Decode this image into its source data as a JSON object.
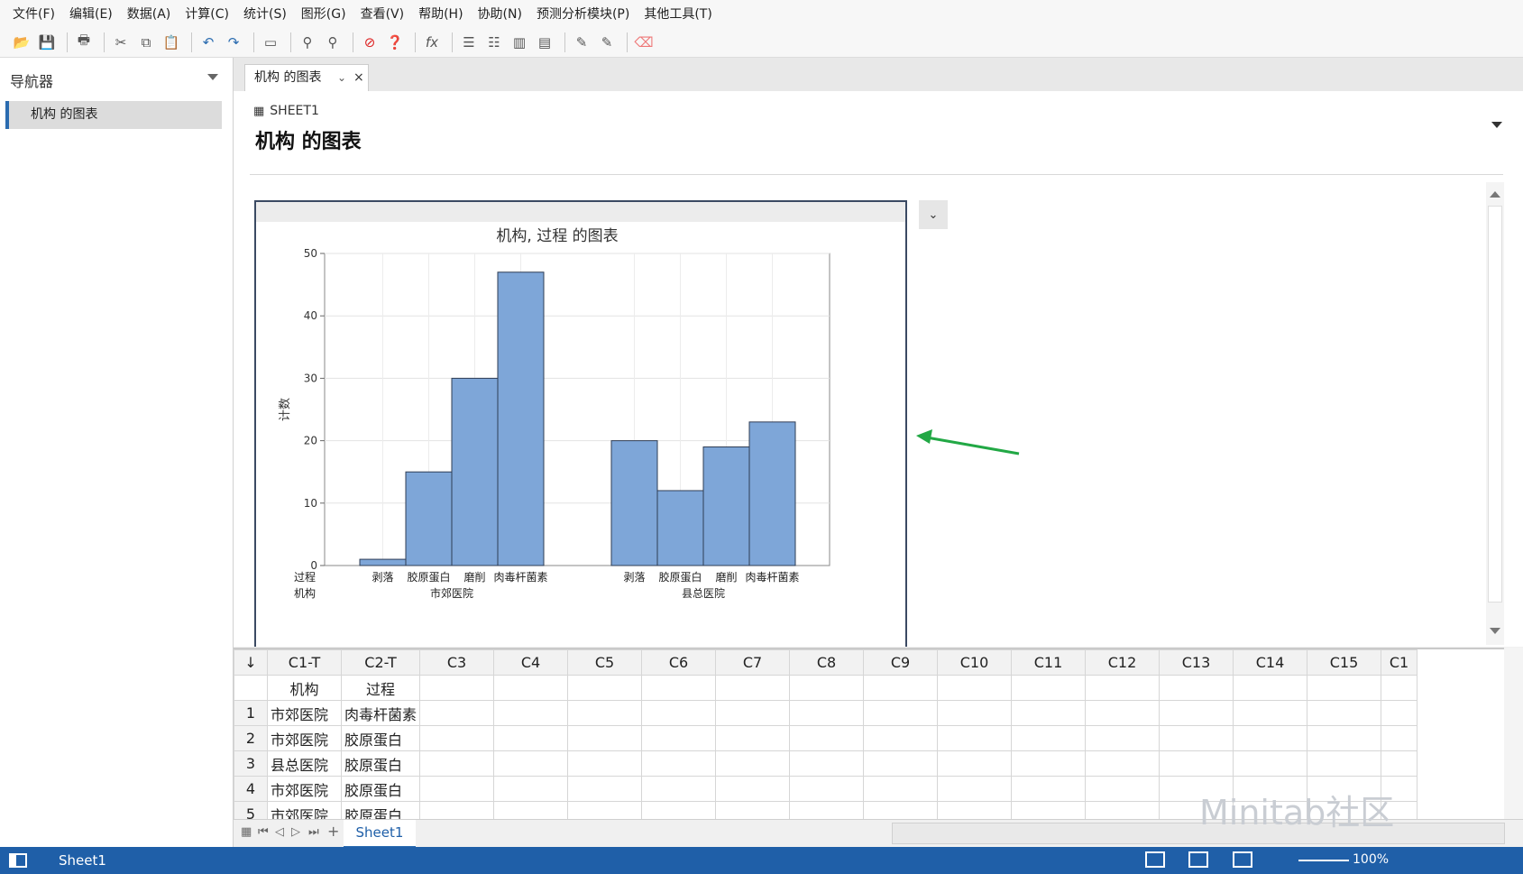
{
  "menu": [
    "文件(F)",
    "编辑(E)",
    "数据(A)",
    "计算(C)",
    "统计(S)",
    "图形(G)",
    "查看(V)",
    "帮助(H)",
    "协助(N)",
    "预测分析模块(P)",
    "其他工具(T)"
  ],
  "toolbar_icons": [
    "open-icon",
    "save-icon",
    "print-icon",
    "cut-icon",
    "copy-icon",
    "paste-icon",
    "undo-icon",
    "redo-icon",
    "window-icon",
    "find-icon",
    "replace-icon",
    "stop-icon",
    "help-icon",
    "fx-icon",
    "align-icon",
    "align2-icon",
    "chart-icon",
    "chart2-icon",
    "brush-icon",
    "brush2-icon",
    "eraser-icon"
  ],
  "navigator": {
    "title": "导航器",
    "item": "机构 的图表"
  },
  "tab": {
    "label": "机构 的图表",
    "close": "×",
    "chevron": "⌄"
  },
  "content": {
    "sheet_label": "SHEET1",
    "title": "机构 的图表"
  },
  "chart_data": {
    "type": "bar",
    "title": "机构, 过程 的图表",
    "ylabel": "计数",
    "ylim": [
      0,
      50
    ],
    "yticks": [
      0,
      10,
      20,
      30,
      40,
      50
    ],
    "row_labels": [
      "过程",
      "机构"
    ],
    "groups": [
      {
        "name": "市郊医院",
        "categories": [
          "剥落",
          "胶原蛋白",
          "磨削",
          "肉毒杆菌素"
        ],
        "values": [
          1,
          15,
          30,
          47
        ]
      },
      {
        "name": "县总医院",
        "categories": [
          "剥落",
          "胶原蛋白",
          "磨削",
          "肉毒杆菌素"
        ],
        "values": [
          20,
          12,
          19,
          23
        ]
      }
    ],
    "bar_color": "#7ea6d8",
    "grid": true
  },
  "worksheet": {
    "columns": [
      "C1-T",
      "C2-T",
      "C3",
      "C4",
      "C5",
      "C6",
      "C7",
      "C8",
      "C9",
      "C10",
      "C11",
      "C12",
      "C13",
      "C14",
      "C15",
      "C1"
    ],
    "names": [
      "机构",
      "过程"
    ],
    "rows": [
      [
        "市郊医院",
        "肉毒杆菌素"
      ],
      [
        "市郊医院",
        "胶原蛋白"
      ],
      [
        "县总医院",
        "胶原蛋白"
      ],
      [
        "市郊医院",
        "胶原蛋白"
      ],
      [
        "市郊医院",
        "胶原蛋白"
      ]
    ]
  },
  "sheet_tab": "Sheet1",
  "status": {
    "sheet": "Sheet1",
    "zoom": "100%"
  },
  "watermark": "Minitab社区"
}
